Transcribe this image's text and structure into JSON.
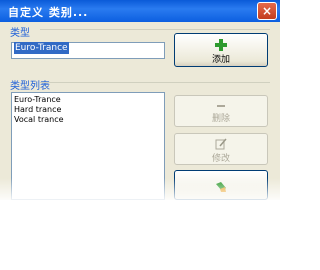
{
  "window": {
    "title": "自定义 类别..."
  },
  "type_group": {
    "label": "类型",
    "input_value": "Euro-Trance"
  },
  "type_list_group": {
    "label": "类型列表",
    "items": [
      "Euro-Trance",
      "Hard trance",
      "Vocal trance"
    ]
  },
  "buttons": {
    "add": {
      "label": "添加",
      "icon": "plus-icon"
    },
    "delete": {
      "label": "删除",
      "icon": "minus-icon"
    },
    "edit": {
      "label": "修改",
      "icon": "edit-icon"
    },
    "other": {
      "icon": "brush-icon"
    }
  },
  "colors": {
    "group_label": "#1c5ed8",
    "titlebar": "#0a5ad8",
    "selection": "#316ac5"
  }
}
